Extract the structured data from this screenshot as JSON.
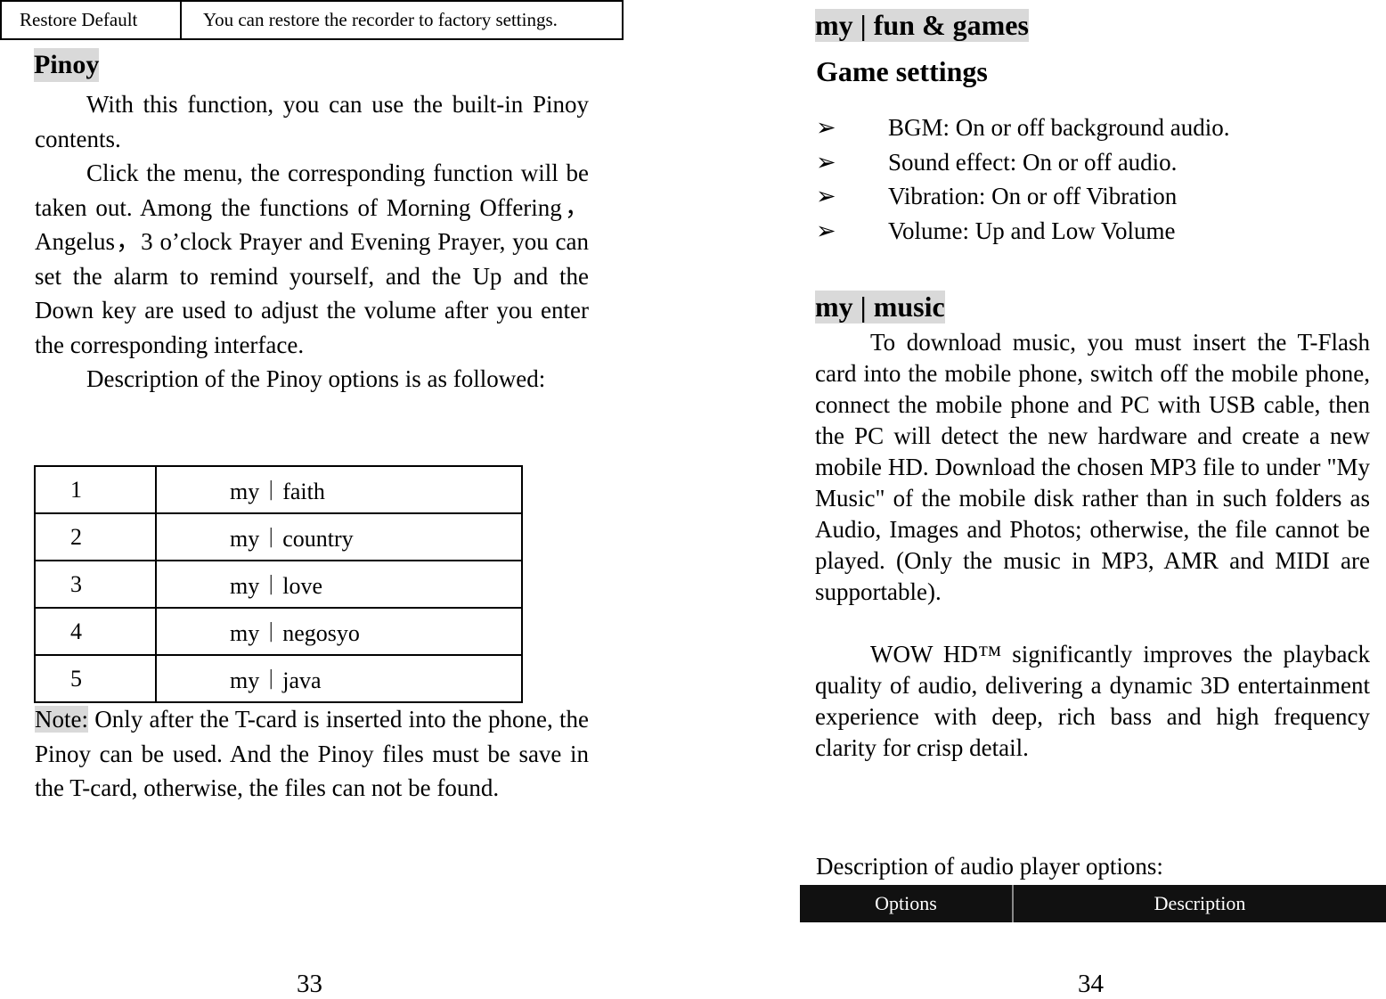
{
  "top_table": {
    "option": "Restore Default",
    "description": "You can restore the recorder to factory settings."
  },
  "left": {
    "heading": "Pinoy",
    "paragraphs": [
      "With this function, you can use the built-in Pinoy contents.",
      "Click the menu, the corresponding function will be taken out. Among the functions of Morning Offering，Angelus，3 o’clock Prayer and Evening Prayer, you can set the alarm to remind yourself, and the Up and the Down key are used to adjust the volume after you enter the corresponding interface.",
      "Description of the Pinoy options is as followed:"
    ],
    "options": [
      {
        "num": "1",
        "label": "my︱faith"
      },
      {
        "num": "2",
        "label": "my︱country"
      },
      {
        "num": "3",
        "label": "my︱love"
      },
      {
        "num": "4",
        "label": "my︱negosyo"
      },
      {
        "num": "5",
        "label": "my︱java"
      }
    ],
    "note_label": "Note:",
    "note": " Only after the T-card is inserted into the phone, the Pinoy can be used. And the Pinoy files must be save in the T-card, otherwise, the files can not be found.",
    "page": "33"
  },
  "right": {
    "heading1": "my | fun & games",
    "subheading": "Game settings",
    "bullet_icon": "arrowhead-bullet",
    "bullets": [
      "BGM: On or off background audio.",
      "Sound effect: On or off audio.",
      "Vibration: On or off Vibration",
      "Volume: Up and Low Volume"
    ],
    "heading2": "my | music",
    "paragraphs": [
      "To download music, you must insert the T-Flash card into the mobile phone, switch off the mobile phone, connect the mobile phone and PC with USB cable, then the PC will detect the new hardware and create a new mobile HD. Download the chosen MP3 file to under \"My Music\" of the mobile disk rather than in such folders as Audio, Images and Photos; otherwise, the file cannot be played. (Only the music in MP3, AMR and MIDI are supportable).",
      "WOW HD™ significantly improves the playback quality of audio, delivering a dynamic 3D entertainment experience with deep, rich bass and high frequency clarity for crisp detail."
    ],
    "desc_label": "Description of audio player options:",
    "table_headers": [
      "Options",
      "Description"
    ],
    "page": "34"
  }
}
